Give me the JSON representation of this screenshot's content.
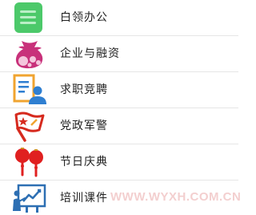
{
  "menu": {
    "items": [
      {
        "label": "白领办公",
        "icon": "notebook-icon",
        "accent": "#4cc96a"
      },
      {
        "label": "企业与融资",
        "icon": "money-bag-icon",
        "accent": "#c8317a"
      },
      {
        "label": "求职竞聘",
        "icon": "resume-person-icon",
        "accent": "#3a8fd6"
      },
      {
        "label": "党政军警",
        "icon": "red-flag-icon",
        "accent": "#d62a1e"
      },
      {
        "label": "节日庆典",
        "icon": "lantern-icon",
        "accent": "#e02020"
      },
      {
        "label": "培训课件",
        "icon": "presentation-board-icon",
        "accent": "#2d6fb3"
      }
    ]
  },
  "watermark": {
    "text": "WWW.WYXH.COM.CN",
    "color": "#f2c7c7"
  }
}
